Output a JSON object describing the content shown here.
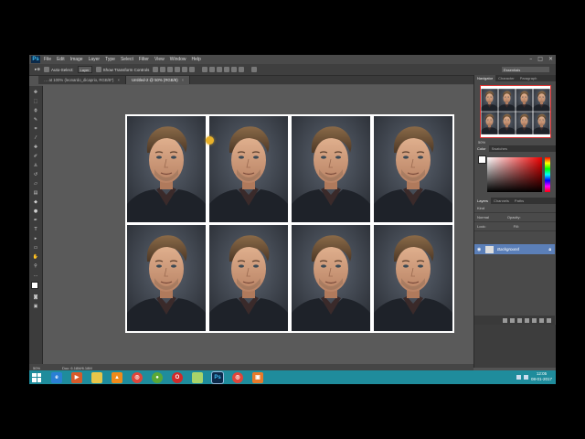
{
  "app": {
    "logo": "Ps",
    "menu": [
      "File",
      "Edit",
      "Image",
      "Layer",
      "Type",
      "Select",
      "Filter",
      "View",
      "Window",
      "Help"
    ]
  },
  "options": {
    "auto_select_label": "Auto-Select:",
    "auto_select_value": "Layer",
    "transform_label": "Show Transform Controls",
    "workspace": "Essentials"
  },
  "tabs": [
    {
      "label": "… at 100% (leonardo_dicaprio, RGB/8*)",
      "active": false
    },
    {
      "label": "Untitled-2 @ 50% (RGB/8)",
      "active": true
    }
  ],
  "status": {
    "zoom": "50%",
    "doc": "Doc: 6.18M/6.18M"
  },
  "panels": {
    "navigator_tabs": [
      "Navigator",
      "Character",
      "Paragraph"
    ],
    "navigator_zoom": "50%",
    "color_tabs": [
      "Color",
      "Swatches"
    ],
    "layers_tabs": [
      "Layers",
      "Channels",
      "Paths"
    ],
    "layers_kind": "Kind",
    "blend_mode": "Normal",
    "opacity_label": "Opacity:",
    "lock_label": "Lock:",
    "fill_label": "Fill:",
    "layer_name": "Background"
  },
  "taskbar": {
    "apps": [
      "explorer",
      "media",
      "folder",
      "vlc",
      "chrome",
      "green",
      "opera",
      "files",
      "photoshop",
      "chrome2",
      "orange"
    ],
    "time": "12:05",
    "date": "08-01-2017"
  },
  "colors": {
    "taskbar": "#1f8c9c",
    "ps_blue": "#3ec0f5",
    "layer_selected": "#5b7fb8",
    "cursor": "#e8b12a"
  }
}
